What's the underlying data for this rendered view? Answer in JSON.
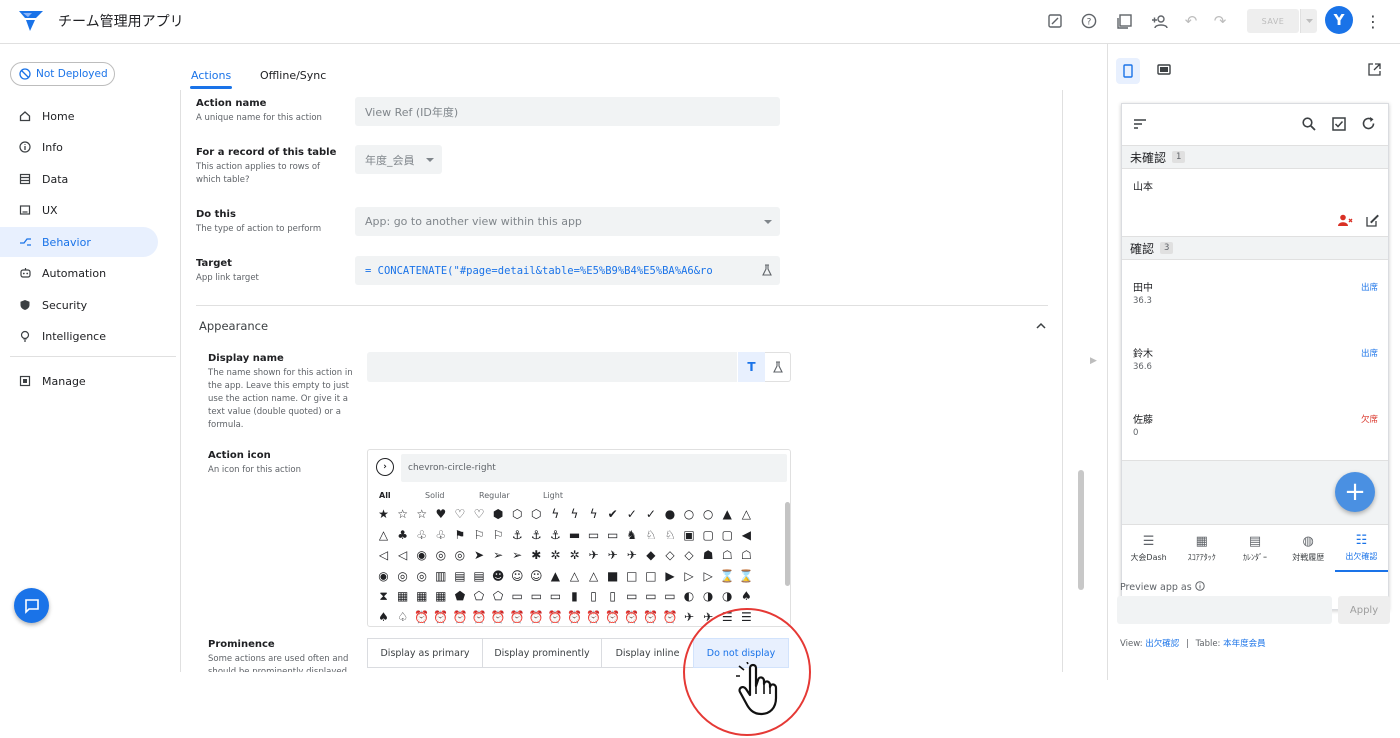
{
  "app": {
    "title": "チーム管理用アプリ",
    "save_label": "SAVE",
    "avatar_initial": "Y"
  },
  "nav": {
    "deploy_status": "Not Deployed",
    "items": [
      {
        "label": "Home",
        "icon": "home-icon"
      },
      {
        "label": "Info",
        "icon": "info-icon"
      },
      {
        "label": "Data",
        "icon": "data-icon"
      },
      {
        "label": "UX",
        "icon": "ux-icon"
      },
      {
        "label": "Behavior",
        "icon": "behavior-icon"
      },
      {
        "label": "Automation",
        "icon": "automation-icon"
      },
      {
        "label": "Security",
        "icon": "security-icon"
      },
      {
        "label": "Intelligence",
        "icon": "intelligence-icon"
      }
    ],
    "manage": {
      "label": "Manage",
      "icon": "manage-icon"
    }
  },
  "tabs": {
    "actions": "Actions",
    "offline": "Offline/Sync"
  },
  "form": {
    "action_name": {
      "label": "Action name",
      "help": "A unique name for this action",
      "value": "View Ref (ID年度)"
    },
    "for_record": {
      "label": "For a record of this table",
      "help": "This action applies to rows of which table?",
      "value": "年度_会員"
    },
    "do_this": {
      "label": "Do this",
      "help": "The type of action to perform",
      "value": "App: go to another view within this app"
    },
    "target": {
      "label": "Target",
      "help": "App link target",
      "value": "= CONCATENATE(\"#page=detail&table=%E5%B9%B4%E5%BA%A6&ro"
    },
    "appearance": {
      "title": "Appearance"
    },
    "display_name": {
      "label": "Display name",
      "help": "The name shown for this action in the app. Leave this empty to just use the action name. Or give it a text value (double quoted) or a formula.",
      "text_btn": "T"
    },
    "action_icon": {
      "label": "Action icon",
      "help": "An icon for this action",
      "search_value": "chevron-circle-right",
      "styles": [
        "All",
        "Solid",
        "Regular",
        "Light"
      ]
    },
    "prominence": {
      "label": "Prominence",
      "help": "Some actions are used often and should be prominently displayed",
      "options": [
        "Display as primary",
        "Display prominently",
        "Display inline",
        "Do not display"
      ],
      "selected": "Do not display"
    }
  },
  "icon_rows": [
    [
      "★",
      "☆",
      "☆",
      "♥",
      "♡",
      "♡",
      "⬢",
      "⬡",
      "⬡",
      "ϟ",
      "ϟ",
      "ϟ",
      "✔",
      "✓",
      "✓",
      "●",
      "○",
      "○",
      "▲",
      "△"
    ],
    [
      "△",
      "♣",
      "♧",
      "♧",
      "⚑",
      "⚐",
      "⚐",
      "⚓",
      "⚓",
      "⚓",
      "▬",
      "▭",
      "▭",
      "♞",
      "♘",
      "♘",
      "▣",
      "▢",
      "▢",
      "◀"
    ],
    [
      "◁",
      "◁",
      "◉",
      "◎",
      "◎",
      "➤",
      "➢",
      "➢",
      "✱",
      "✲",
      "✲",
      "✈",
      "✈",
      "✈",
      "◆",
      "◇",
      "◇",
      "☗",
      "☖",
      "☖"
    ],
    [
      "◉",
      "◎",
      "◎",
      "▥",
      "▤",
      "▤",
      "☻",
      "☺",
      "☺",
      "▲",
      "△",
      "△",
      "■",
      "□",
      "□",
      "▶",
      "▷",
      "▷",
      "⌛",
      "⌛"
    ],
    [
      "⧗",
      "▦",
      "▦",
      "▦",
      "⬟",
      "⬠",
      "⬠",
      "▭",
      "▭",
      "▭",
      "▮",
      "▯",
      "▯",
      "▭",
      "▭",
      "▭",
      "◐",
      "◑",
      "◑",
      "♠"
    ],
    [
      "♠",
      "♤",
      "⏰",
      "⏰",
      "⏰",
      "⏰",
      "⏰",
      "⏰",
      "⏰",
      "⏰",
      "⏰",
      "⏰",
      "⏰",
      "⏰",
      "⏰",
      "⏰",
      "✈",
      "✈",
      "☰",
      "☰"
    ]
  ],
  "preview": {
    "groups": [
      {
        "name": "未確認",
        "count": "1",
        "rows": [
          {
            "name": "山本"
          }
        ]
      },
      {
        "name": "確認",
        "count": "3",
        "rows": [
          {
            "name": "田中",
            "value": "36.3",
            "status": "出席"
          },
          {
            "name": "鈴木",
            "value": "36.6",
            "status": "出席"
          },
          {
            "name": "佐藤",
            "value": "0",
            "status": "欠席"
          }
        ]
      }
    ],
    "bottom_tabs": [
      "大会Dash",
      "ｽｺｱｱﾀｯｸ",
      "ｶﾚﾝﾀﾞｰ",
      "対戦履歴",
      "出欠確認"
    ],
    "active_tab": "出欠確認",
    "preview_as_label": "Preview app as",
    "apply_label": "Apply",
    "view_label": "View:",
    "view_value": "出欠確認",
    "table_label": "Table:",
    "table_value": "本年度会員",
    "separator": "|"
  },
  "colors": {
    "accent": "#1a73e8",
    "absent": "#d93025",
    "annotation": "#e53935"
  }
}
